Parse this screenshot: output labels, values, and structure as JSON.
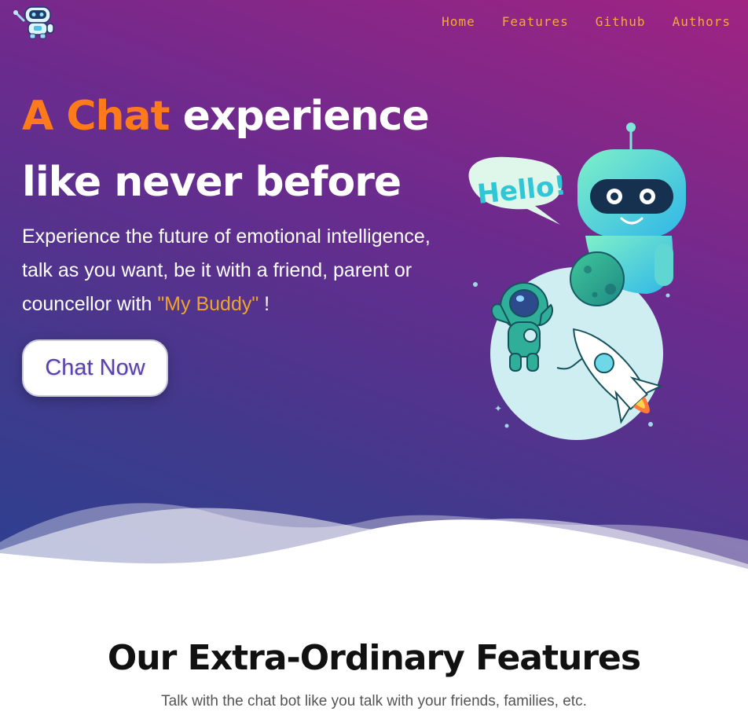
{
  "nav": {
    "items": [
      {
        "label": "Home"
      },
      {
        "label": "Features"
      },
      {
        "label": "Github"
      },
      {
        "label": "Authors"
      }
    ]
  },
  "hero": {
    "headline_accent": "A Chat",
    "headline_rest": " experience like never before",
    "subtitle_text": "Experience the future of emotional intelligence, talk as you want, be it with a friend, parent or councellor with ",
    "subtitle_buddy": "\"My Buddy\"",
    "subtitle_end": " !",
    "cta_label": "Chat Now",
    "bubble_text": "Hello!"
  },
  "features": {
    "title": "Our Extra-Ordinary Features",
    "subtitle": "Talk with the chat bot like you talk with your friends, families, etc."
  },
  "colors": {
    "accent_orange": "#ff7a1a",
    "nav_gold": "#f4a93a",
    "buddy_gold": "#f0a32c",
    "cta_text": "#5b3fb0",
    "hero_top": "#a02382",
    "hero_bottom": "#2d4090"
  },
  "icons": {
    "logo": "robot-logo-icon",
    "illustration": "robot-astronaut-rocket-illustration"
  }
}
